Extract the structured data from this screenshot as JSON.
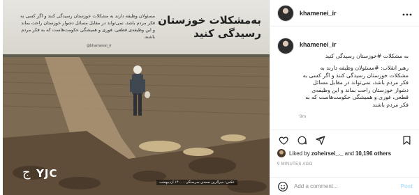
{
  "photo": {
    "headline": "به‌مشکلات خوزستان رسیدگی کنید",
    "subtext": "مسئولان وظیفه دارند به مشکلات خوزستان رسیدگی کنند و اگر کسی به فکر مردم باشد، نمی‌تواند در مقابل مسائل دشوار خوزستان راحت بماند و این وظیفه‌ی قطعی، فوری و همیشگی حکومت‌هاست که به فکر مردم باشند.",
    "handle_tag": "@khamenei_ir",
    "photo_credit": "عکس: حیرالزین صمدی سرستگی - ۱۴۰۰ اردیبهشت",
    "watermark": "YJC",
    "watermark_mark": "ج"
  },
  "header": {
    "username": "khamenei_ir",
    "avatar_icon": "profile-avatar",
    "more_icon": "more-horizontal-icon"
  },
  "caption": {
    "username": "khamenei_ir",
    "title_line": "به مشکلات #خوزستان رسیدگی کنید",
    "text": "رهبر انقلاب: #مسئولان وظیفه دارند به مشکلات خوزستان رسیدگی کنند و اگر کسی به فکر مردم باشد، نمی‌تواند در مقابل مسائل دشوار خوزستان راحت بماند و این وظیفه‌ی قطعی، فوری و همیشگی حکومت‌هاست که به فکر مردم باشند",
    "time_ago": "9m"
  },
  "actions": {
    "icons": [
      "heart-icon",
      "comment-icon",
      "share-icon",
      "bookmark-icon"
    ]
  },
  "likes": {
    "prefix": "Liked by ",
    "user": "zoheirsei_._",
    "middle": " and ",
    "count": "10,196 others"
  },
  "posted_time": "9 MINUTES AGO",
  "add_comment": {
    "placeholder": "Add a comment...",
    "post_label": "Post"
  },
  "colors": {
    "accent": "#0095f6",
    "post_disabled": "#b2dffc",
    "muted": "#8e8e8e"
  }
}
